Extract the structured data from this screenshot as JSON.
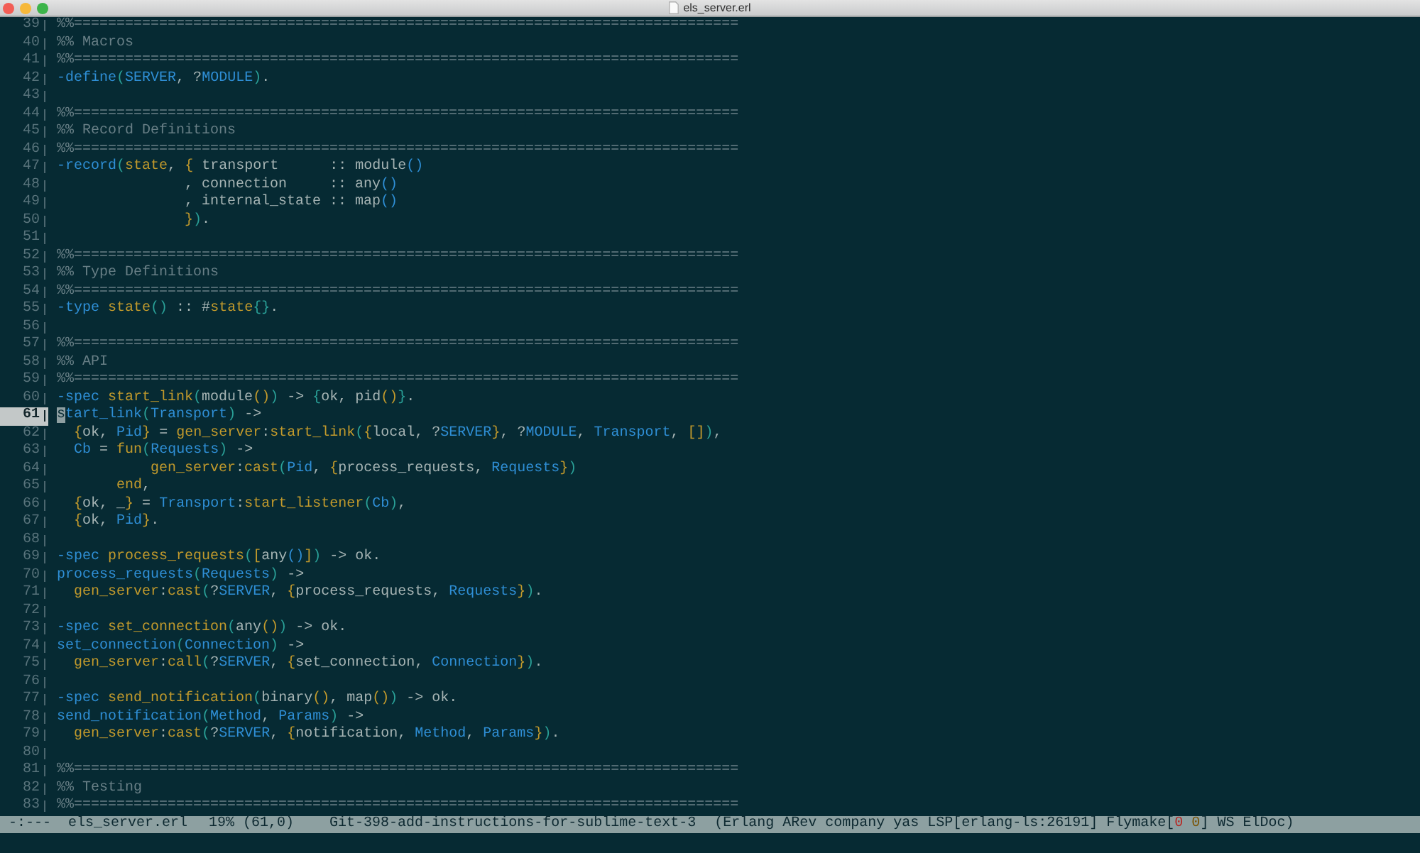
{
  "window": {
    "title": "els_server.erl"
  },
  "editor": {
    "lines": [
      {
        "number": "39",
        "current": false,
        "segments": [
          {
            "kind": "comment",
            "text": "%%=============================================================================="
          }
        ]
      },
      {
        "number": "40",
        "current": false,
        "segments": [
          {
            "kind": "comment",
            "text": "%% Macros"
          }
        ]
      },
      {
        "number": "41",
        "current": false,
        "segments": [
          {
            "kind": "comment",
            "text": "%%=============================================================================="
          }
        ]
      },
      {
        "number": "42",
        "current": false,
        "segments": [
          {
            "kind": "attribute",
            "text": "-define"
          },
          {
            "kind": "delim1",
            "text": "("
          },
          {
            "kind": "macro",
            "text": "SERVER"
          },
          {
            "kind": "plain",
            "text": ", ?"
          },
          {
            "kind": "macro",
            "text": "MODULE"
          },
          {
            "kind": "delim1",
            "text": ")"
          },
          {
            "kind": "plain",
            "text": "."
          }
        ]
      },
      {
        "number": "43",
        "current": false
      },
      {
        "number": "44",
        "current": false,
        "segments": [
          {
            "kind": "comment",
            "text": "%%=============================================================================="
          }
        ]
      },
      {
        "number": "45",
        "current": false,
        "segments": [
          {
            "kind": "comment",
            "text": "%% Record Definitions"
          }
        ]
      },
      {
        "number": "46",
        "current": false,
        "segments": [
          {
            "kind": "comment",
            "text": "%%=============================================================================="
          }
        ]
      },
      {
        "number": "47",
        "current": false,
        "segments": [
          {
            "kind": "attribute",
            "text": "-record"
          },
          {
            "kind": "delim1",
            "text": "("
          },
          {
            "kind": "record",
            "text": "state"
          },
          {
            "kind": "plain",
            "text": ", "
          },
          {
            "kind": "delim2",
            "text": "{"
          },
          {
            "kind": "plain",
            "text": " transport      :: module"
          },
          {
            "kind": "delim3",
            "text": "()"
          }
        ]
      },
      {
        "number": "48",
        "current": false,
        "segments": [
          {
            "kind": "plain",
            "text": "               , connection     :: any"
          },
          {
            "kind": "delim3",
            "text": "()"
          }
        ]
      },
      {
        "number": "49",
        "current": false,
        "segments": [
          {
            "kind": "plain",
            "text": "               , internal_state :: map"
          },
          {
            "kind": "delim3",
            "text": "()"
          }
        ]
      },
      {
        "number": "50",
        "current": false,
        "segments": [
          {
            "kind": "delim2",
            "text": "               }"
          },
          {
            "kind": "delim1",
            "text": ")"
          },
          {
            "kind": "plain",
            "text": "."
          }
        ]
      },
      {
        "number": "51",
        "current": false
      },
      {
        "number": "52",
        "current": false,
        "segments": [
          {
            "kind": "comment",
            "text": "%%=============================================================================="
          }
        ]
      },
      {
        "number": "53",
        "current": false,
        "segments": [
          {
            "kind": "comment",
            "text": "%% Type Definitions"
          }
        ]
      },
      {
        "number": "54",
        "current": false,
        "segments": [
          {
            "kind": "comment",
            "text": "%%=============================================================================="
          }
        ]
      },
      {
        "number": "55",
        "current": false,
        "segments": [
          {
            "kind": "attribute",
            "text": "-type"
          },
          {
            "kind": "record",
            "text": " state"
          },
          {
            "kind": "delim1",
            "text": "()"
          },
          {
            "kind": "plain",
            "text": " :: #"
          },
          {
            "kind": "record",
            "text": "state"
          },
          {
            "kind": "delim1",
            "text": "{}"
          },
          {
            "kind": "plain",
            "text": "."
          }
        ]
      },
      {
        "number": "56",
        "current": false
      },
      {
        "number": "57",
        "current": false,
        "segments": [
          {
            "kind": "comment",
            "text": "%%=============================================================================="
          }
        ]
      },
      {
        "number": "58",
        "current": false,
        "segments": [
          {
            "kind": "comment",
            "text": "%% API"
          }
        ]
      },
      {
        "number": "59",
        "current": false,
        "segments": [
          {
            "kind": "comment",
            "text": "%%=============================================================================="
          }
        ]
      },
      {
        "number": "60",
        "current": false,
        "segments": [
          {
            "kind": "attribute",
            "text": "-spec"
          },
          {
            "kind": "function",
            "text": " start_link"
          },
          {
            "kind": "delim1",
            "text": "("
          },
          {
            "kind": "plain",
            "text": "module"
          },
          {
            "kind": "delim2",
            "text": "()"
          },
          {
            "kind": "delim1",
            "text": ")"
          },
          {
            "kind": "plain",
            "text": " -> "
          },
          {
            "kind": "delim1",
            "text": "{"
          },
          {
            "kind": "plain",
            "text": "ok, pid"
          },
          {
            "kind": "delim2",
            "text": "()"
          },
          {
            "kind": "delim1",
            "text": "}"
          },
          {
            "kind": "plain",
            "text": "."
          }
        ]
      },
      {
        "number": "61",
        "current": true,
        "segments": [
          {
            "kind": "definition",
            "text": "start_link"
          },
          {
            "kind": "delim1",
            "text": "("
          },
          {
            "kind": "variable",
            "text": "Transport"
          },
          {
            "kind": "delim1",
            "text": ")"
          },
          {
            "kind": "plain",
            "text": " ->"
          }
        ]
      },
      {
        "number": "62",
        "current": false,
        "segments": [
          {
            "kind": "delim2",
            "text": "  {"
          },
          {
            "kind": "plain",
            "text": "ok, "
          },
          {
            "kind": "variable",
            "text": "Pid"
          },
          {
            "kind": "delim2",
            "text": "}"
          },
          {
            "kind": "plain",
            "text": " = "
          },
          {
            "kind": "function",
            "text": "gen_server"
          },
          {
            "kind": "plain",
            "text": ":"
          },
          {
            "kind": "function",
            "text": "start_link"
          },
          {
            "kind": "delim1",
            "text": "("
          },
          {
            "kind": "delim2",
            "text": "{"
          },
          {
            "kind": "plain",
            "text": "local, ?"
          },
          {
            "kind": "macro",
            "text": "SERVER"
          },
          {
            "kind": "delim2",
            "text": "}"
          },
          {
            "kind": "plain",
            "text": ", ?"
          },
          {
            "kind": "macro",
            "text": "MODULE"
          },
          {
            "kind": "plain",
            "text": ", "
          },
          {
            "kind": "variable",
            "text": "Transport"
          },
          {
            "kind": "plain",
            "text": ", "
          },
          {
            "kind": "delim2",
            "text": "[]"
          },
          {
            "kind": "delim1",
            "text": ")"
          },
          {
            "kind": "plain",
            "text": ","
          }
        ]
      },
      {
        "number": "63",
        "current": false,
        "segments": [
          {
            "kind": "variable",
            "text": "  Cb"
          },
          {
            "kind": "plain",
            "text": " = "
          },
          {
            "kind": "reserved",
            "text": "fun"
          },
          {
            "kind": "delim1",
            "text": "("
          },
          {
            "kind": "variable",
            "text": "Requests"
          },
          {
            "kind": "delim1",
            "text": ")"
          },
          {
            "kind": "plain",
            "text": " ->"
          }
        ]
      },
      {
        "number": "64",
        "current": false,
        "segments": [
          {
            "kind": "function",
            "text": "           gen_server"
          },
          {
            "kind": "plain",
            "text": ":"
          },
          {
            "kind": "function",
            "text": "cast"
          },
          {
            "kind": "delim1",
            "text": "("
          },
          {
            "kind": "variable",
            "text": "Pid"
          },
          {
            "kind": "plain",
            "text": ", "
          },
          {
            "kind": "delim2",
            "text": "{"
          },
          {
            "kind": "plain",
            "text": "process_requests, "
          },
          {
            "kind": "variable",
            "text": "Requests"
          },
          {
            "kind": "delim2",
            "text": "}"
          },
          {
            "kind": "delim1",
            "text": ")"
          }
        ]
      },
      {
        "number": "65",
        "current": false,
        "segments": [
          {
            "kind": "reserved",
            "text": "       end"
          },
          {
            "kind": "plain",
            "text": ","
          }
        ]
      },
      {
        "number": "66",
        "current": false,
        "segments": [
          {
            "kind": "delim2",
            "text": "  {"
          },
          {
            "kind": "plain",
            "text": "ok, _"
          },
          {
            "kind": "delim2",
            "text": "}"
          },
          {
            "kind": "plain",
            "text": " = "
          },
          {
            "kind": "variable",
            "text": "Transport"
          },
          {
            "kind": "plain",
            "text": ":"
          },
          {
            "kind": "function",
            "text": "start_listener"
          },
          {
            "kind": "delim1",
            "text": "("
          },
          {
            "kind": "variable",
            "text": "Cb"
          },
          {
            "kind": "delim1",
            "text": ")"
          },
          {
            "kind": "plain",
            "text": ","
          }
        ]
      },
      {
        "number": "67",
        "current": false,
        "segments": [
          {
            "kind": "delim2",
            "text": "  {"
          },
          {
            "kind": "plain",
            "text": "ok, "
          },
          {
            "kind": "variable",
            "text": "Pid"
          },
          {
            "kind": "delim2",
            "text": "}"
          },
          {
            "kind": "plain",
            "text": "."
          }
        ]
      },
      {
        "number": "68",
        "current": false
      },
      {
        "number": "69",
        "current": false,
        "segments": [
          {
            "kind": "attribute",
            "text": "-spec"
          },
          {
            "kind": "function",
            "text": " process_requests"
          },
          {
            "kind": "delim1",
            "text": "("
          },
          {
            "kind": "delim2",
            "text": "["
          },
          {
            "kind": "plain",
            "text": "any"
          },
          {
            "kind": "delim3",
            "text": "()"
          },
          {
            "kind": "delim2",
            "text": "]"
          },
          {
            "kind": "delim1",
            "text": ")"
          },
          {
            "kind": "plain",
            "text": " -> ok."
          }
        ]
      },
      {
        "number": "70",
        "current": false,
        "segments": [
          {
            "kind": "definition",
            "text": "process_requests"
          },
          {
            "kind": "delim1",
            "text": "("
          },
          {
            "kind": "variable",
            "text": "Requests"
          },
          {
            "kind": "delim1",
            "text": ")"
          },
          {
            "kind": "plain",
            "text": " ->"
          }
        ]
      },
      {
        "number": "71",
        "current": false,
        "segments": [
          {
            "kind": "function",
            "text": "  gen_server"
          },
          {
            "kind": "plain",
            "text": ":"
          },
          {
            "kind": "function",
            "text": "cast"
          },
          {
            "kind": "delim1",
            "text": "("
          },
          {
            "kind": "plain",
            "text": "?"
          },
          {
            "kind": "macro",
            "text": "SERVER"
          },
          {
            "kind": "plain",
            "text": ", "
          },
          {
            "kind": "delim2",
            "text": "{"
          },
          {
            "kind": "plain",
            "text": "process_requests, "
          },
          {
            "kind": "variable",
            "text": "Requests"
          },
          {
            "kind": "delim2",
            "text": "}"
          },
          {
            "kind": "delim1",
            "text": ")"
          },
          {
            "kind": "plain",
            "text": "."
          }
        ]
      },
      {
        "number": "72",
        "current": false
      },
      {
        "number": "73",
        "current": false,
        "segments": [
          {
            "kind": "attribute",
            "text": "-spec"
          },
          {
            "kind": "function",
            "text": " set_connection"
          },
          {
            "kind": "delim1",
            "text": "("
          },
          {
            "kind": "plain",
            "text": "any"
          },
          {
            "kind": "delim2",
            "text": "()"
          },
          {
            "kind": "delim1",
            "text": ")"
          },
          {
            "kind": "plain",
            "text": " -> ok."
          }
        ]
      },
      {
        "number": "74",
        "current": false,
        "segments": [
          {
            "kind": "definition",
            "text": "set_connection"
          },
          {
            "kind": "delim1",
            "text": "("
          },
          {
            "kind": "variable",
            "text": "Connection"
          },
          {
            "kind": "delim1",
            "text": ")"
          },
          {
            "kind": "plain",
            "text": " ->"
          }
        ]
      },
      {
        "number": "75",
        "current": false,
        "segments": [
          {
            "kind": "function",
            "text": "  gen_server"
          },
          {
            "kind": "plain",
            "text": ":"
          },
          {
            "kind": "function",
            "text": "call"
          },
          {
            "kind": "delim1",
            "text": "("
          },
          {
            "kind": "plain",
            "text": "?"
          },
          {
            "kind": "macro",
            "text": "SERVER"
          },
          {
            "kind": "plain",
            "text": ", "
          },
          {
            "kind": "delim2",
            "text": "{"
          },
          {
            "kind": "plain",
            "text": "set_connection, "
          },
          {
            "kind": "variable",
            "text": "Connection"
          },
          {
            "kind": "delim2",
            "text": "}"
          },
          {
            "kind": "delim1",
            "text": ")"
          },
          {
            "kind": "plain",
            "text": "."
          }
        ]
      },
      {
        "number": "76",
        "current": false
      },
      {
        "number": "77",
        "current": false,
        "segments": [
          {
            "kind": "attribute",
            "text": "-spec"
          },
          {
            "kind": "function",
            "text": " send_notification"
          },
          {
            "kind": "delim1",
            "text": "("
          },
          {
            "kind": "plain",
            "text": "binary"
          },
          {
            "kind": "delim2",
            "text": "()"
          },
          {
            "kind": "plain",
            "text": ", map"
          },
          {
            "kind": "delim2",
            "text": "()"
          },
          {
            "kind": "delim1",
            "text": ")"
          },
          {
            "kind": "plain",
            "text": " -> ok."
          }
        ]
      },
      {
        "number": "78",
        "current": false,
        "segments": [
          {
            "kind": "definition",
            "text": "send_notification"
          },
          {
            "kind": "delim1",
            "text": "("
          },
          {
            "kind": "variable",
            "text": "Method"
          },
          {
            "kind": "plain",
            "text": ", "
          },
          {
            "kind": "variable",
            "text": "Params"
          },
          {
            "kind": "delim1",
            "text": ")"
          },
          {
            "kind": "plain",
            "text": " ->"
          }
        ]
      },
      {
        "number": "79",
        "current": false,
        "segments": [
          {
            "kind": "function",
            "text": "  gen_server"
          },
          {
            "kind": "plain",
            "text": ":"
          },
          {
            "kind": "function",
            "text": "cast"
          },
          {
            "kind": "delim1",
            "text": "("
          },
          {
            "kind": "plain",
            "text": "?"
          },
          {
            "kind": "macro",
            "text": "SERVER"
          },
          {
            "kind": "plain",
            "text": ", "
          },
          {
            "kind": "delim2",
            "text": "{"
          },
          {
            "kind": "plain",
            "text": "notification, "
          },
          {
            "kind": "variable",
            "text": "Method"
          },
          {
            "kind": "plain",
            "text": ", "
          },
          {
            "kind": "variable",
            "text": "Params"
          },
          {
            "kind": "delim2",
            "text": "}"
          },
          {
            "kind": "delim1",
            "text": ")"
          },
          {
            "kind": "plain",
            "text": "."
          }
        ]
      },
      {
        "number": "80",
        "current": false
      },
      {
        "number": "81",
        "current": false,
        "segments": [
          {
            "kind": "comment",
            "text": "%%=============================================================================="
          }
        ]
      },
      {
        "number": "82",
        "current": false,
        "segments": [
          {
            "kind": "comment",
            "text": "%% Testing"
          }
        ]
      },
      {
        "number": "83",
        "current": false,
        "segments": [
          {
            "kind": "comment",
            "text": "%%=============================================================================="
          }
        ]
      }
    ]
  },
  "mode_line": {
    "flags": "-:---",
    "buffer": "els_server.erl",
    "position": "19% (61,0)",
    "branch": "Git-398-add-instructions-for-sublime-text-3",
    "modes_before": "(Erlang ARev company yas LSP[erlang-ls:26191] Flymake[",
    "flymake_counts": [
      {
        "text": "0",
        "color": "#b8241f"
      },
      {
        "text": "0",
        "color": "#7a5200"
      }
    ],
    "modes_after": "] WS ElDoc)"
  }
}
